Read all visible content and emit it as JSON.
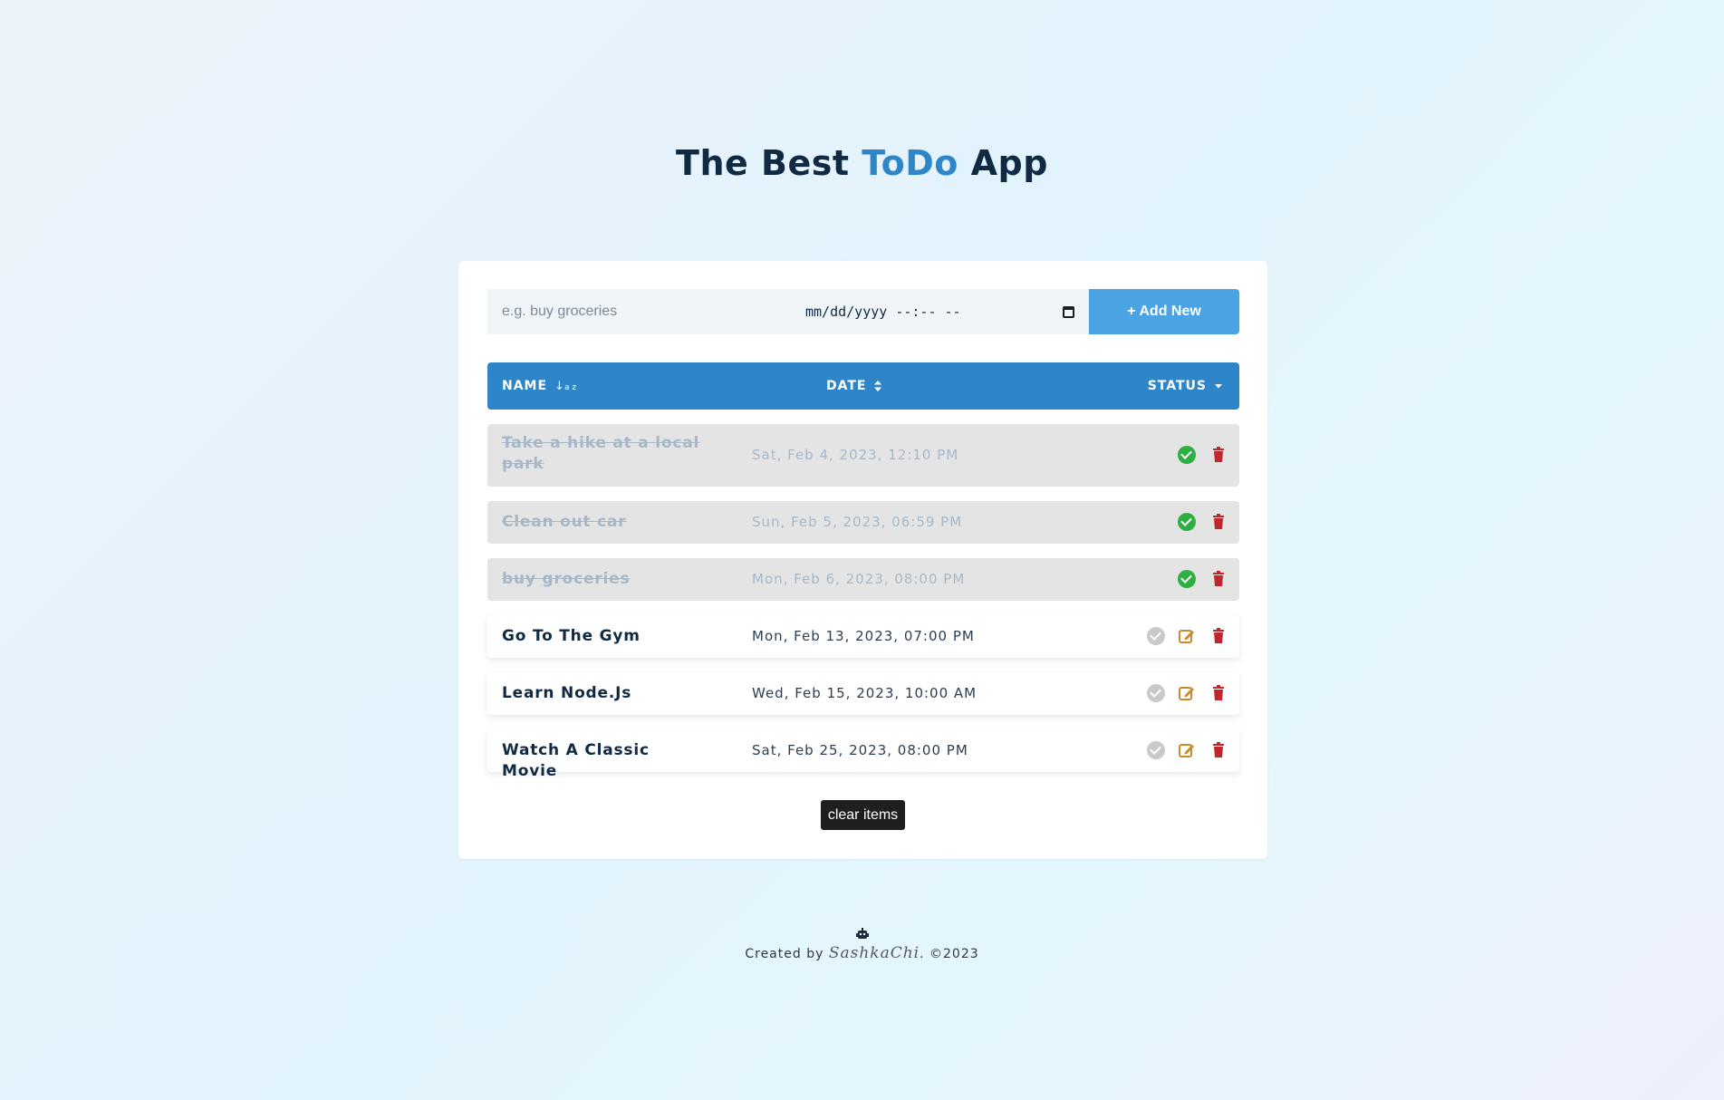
{
  "header": {
    "title_prefix": "The Best",
    "title_accent": "ToDo",
    "title_suffix": "App"
  },
  "form": {
    "name_placeholder": "e.g. buy groceries",
    "date_placeholder": "mm/dd/yyyy --:-- --",
    "add_label": "+ Add New"
  },
  "table": {
    "columns": [
      {
        "label": "NAME",
        "sort_icon": "sort-alpha-icon"
      },
      {
        "label": "DATE",
        "sort_icon": "sort-icon"
      },
      {
        "label": "STATUS",
        "sort_icon": "caret-down-icon"
      }
    ],
    "rows": [
      {
        "name": "Take a hike at a local park",
        "date": "Sat, Feb 4, 2023, 12:10 PM",
        "completed": true
      },
      {
        "name": "Clean out car",
        "date": "Sun, Feb 5, 2023, 06:59 PM",
        "completed": true
      },
      {
        "name": "buy groceries",
        "date": "Mon, Feb 6, 2023, 08:00 PM",
        "completed": true
      },
      {
        "name": "Go To The Gym",
        "date": "Mon, Feb 13, 2023, 07:00 PM",
        "completed": false
      },
      {
        "name": "Learn Node.Js",
        "date": "Wed, Feb 15, 2023, 10:00 AM",
        "completed": false
      },
      {
        "name": "Watch A Classic Movie",
        "date": "Sat, Feb 25, 2023, 08:00 PM",
        "completed": false
      }
    ]
  },
  "clear_label": "clear items",
  "footer": {
    "created_by": "Created by",
    "author": "SashkaChi",
    "copyright": ". ©2023",
    "icon": "robot-icon"
  },
  "colors": {
    "accent": "#2e86c9",
    "add_button": "#4aa3e2",
    "done_check": "#2db043",
    "delete": "#c0262d",
    "edit": "#c98a2e"
  }
}
